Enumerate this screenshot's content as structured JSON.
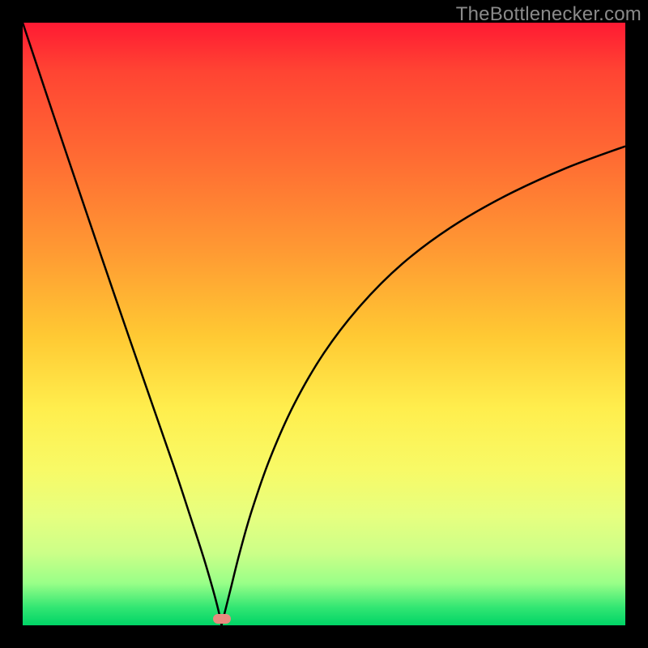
{
  "watermark": "TheBottlenecker.com",
  "colors": {
    "frame": "#000000",
    "curve": "#000000",
    "marker": "#e98b7f"
  },
  "chart_data": {
    "type": "line",
    "title": "",
    "xlabel": "",
    "ylabel": "",
    "xlim": [
      0,
      1
    ],
    "ylim": [
      0,
      1
    ],
    "minimum_x": 0.33,
    "left_branch": [
      {
        "x": 0.0,
        "y": 1.0
      },
      {
        "x": 0.05,
        "y": 0.85
      },
      {
        "x": 0.1,
        "y": 0.702
      },
      {
        "x": 0.15,
        "y": 0.555
      },
      {
        "x": 0.2,
        "y": 0.41
      },
      {
        "x": 0.25,
        "y": 0.266
      },
      {
        "x": 0.28,
        "y": 0.175
      },
      {
        "x": 0.3,
        "y": 0.113
      },
      {
        "x": 0.315,
        "y": 0.062
      },
      {
        "x": 0.325,
        "y": 0.024
      },
      {
        "x": 0.33,
        "y": 0.0
      }
    ],
    "right_branch": [
      {
        "x": 0.33,
        "y": 0.0
      },
      {
        "x": 0.335,
        "y": 0.02
      },
      {
        "x": 0.345,
        "y": 0.06
      },
      {
        "x": 0.36,
        "y": 0.12
      },
      {
        "x": 0.38,
        "y": 0.19
      },
      {
        "x": 0.41,
        "y": 0.276
      },
      {
        "x": 0.45,
        "y": 0.366
      },
      {
        "x": 0.5,
        "y": 0.452
      },
      {
        "x": 0.56,
        "y": 0.53
      },
      {
        "x": 0.63,
        "y": 0.6
      },
      {
        "x": 0.71,
        "y": 0.66
      },
      {
        "x": 0.8,
        "y": 0.712
      },
      {
        "x": 0.9,
        "y": 0.758
      },
      {
        "x": 1.0,
        "y": 0.795
      }
    ]
  }
}
